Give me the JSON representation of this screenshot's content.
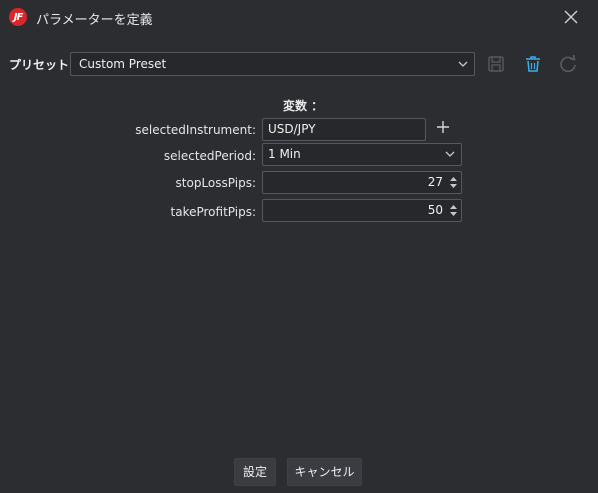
{
  "window": {
    "title": "パラメーターを定義",
    "logo_text": "JF"
  },
  "preset": {
    "label": "プリセット",
    "selected": "Custom Preset"
  },
  "section": {
    "title": "変数 ："
  },
  "params": {
    "instrument": {
      "label": "selectedInstrument:",
      "value": "USD/JPY"
    },
    "period": {
      "label": "selectedPeriod:",
      "value": "1 Min"
    },
    "stop_loss": {
      "label": "stopLossPips:",
      "value": "27"
    },
    "take_profit": {
      "label": "takeProfitPips:",
      "value": "50"
    }
  },
  "footer": {
    "ok_label": "設定",
    "cancel_label": "キャンセル"
  },
  "colors": {
    "background": "#2b2d31",
    "accent": "#3daee9",
    "brand": "#d8262d",
    "disabled_icon": "#5a5d63"
  },
  "icons": [
    "app-logo",
    "close-icon",
    "save-icon",
    "trash-icon",
    "refresh-icon",
    "plus-icon",
    "chevron-down-icon",
    "spinner-arrows-icon"
  ]
}
